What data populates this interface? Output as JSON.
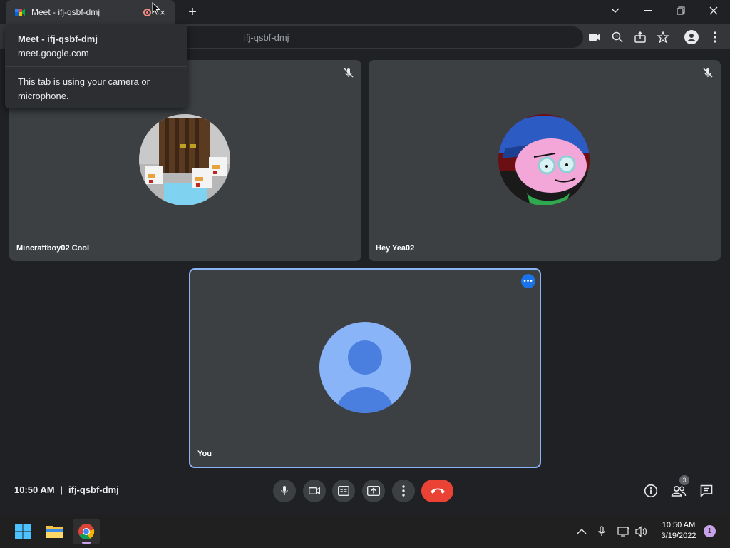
{
  "browser": {
    "tab_title": "Meet - ifj-qsbf-dmj",
    "tab_close": "×",
    "new_tab": "+",
    "omnibox_text": "ifj-qsbf-dmj",
    "icons": [
      "camera-icon",
      "zoom-icon",
      "share-icon",
      "bookmark-star-icon",
      "profile-icon",
      "menu-icon"
    ]
  },
  "hovercard": {
    "title": "Meet - ifj-qsbf-dmj",
    "url": "meet.google.com",
    "note": "This tab is using your camera or microphone."
  },
  "participants": [
    {
      "name": "Mincraftboy02 Cool",
      "muted": true
    },
    {
      "name": "Hey Yea02",
      "muted": true
    }
  ],
  "self": {
    "name": "You",
    "more": "•••"
  },
  "meeting": {
    "time": "10:50 AM",
    "separator": "|",
    "code": "ifj-qsbf-dmj",
    "people_count": "3"
  },
  "taskbar": {
    "time": "10:50 AM",
    "date": "3/19/2022",
    "notifications": "1"
  },
  "colors": {
    "accent": "#8ab4f8",
    "hangup": "#ea4335",
    "tile": "#3c4043",
    "background": "#202124"
  }
}
